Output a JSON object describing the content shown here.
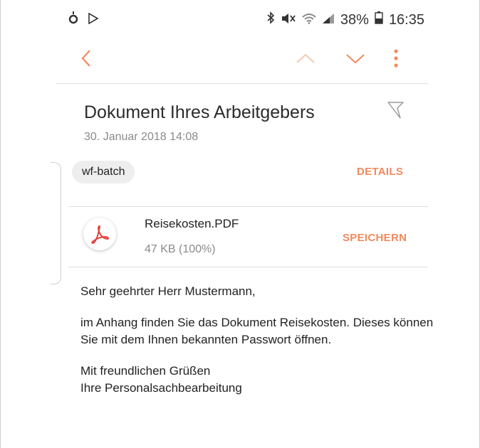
{
  "statusbar": {
    "battery_percent": "38%",
    "time": "16:35"
  },
  "email": {
    "subject": "Dokument Ihres Arbeitgebers",
    "date": "30. Januar 2018  14:08",
    "label_chip": "wf-batch",
    "details_label": "DETAILS"
  },
  "attachment": {
    "filename": "Reisekosten.PDF",
    "size": "47 KB (100%)",
    "save_label": "SPEICHERN"
  },
  "body": {
    "greeting": "Sehr geehrter Herr Mustermann,",
    "paragraph": "im Anhang finden Sie das Dokument Reisekosten. Dieses können Sie mit dem Ihnen bekannten Passwort öffnen.",
    "closing": "Mit freundlichen Grüßen",
    "signature": "Ihre Personalsachbearbeitung"
  },
  "colors": {
    "accent": "#f08a5d",
    "muted": "#8a8a8a"
  },
  "icons": [
    "notification-icon",
    "play-store-icon",
    "bluetooth-icon",
    "mute-icon",
    "wifi-icon",
    "signal-icon",
    "battery-icon",
    "back-chevron-icon",
    "previous-chevron-icon",
    "next-chevron-icon",
    "more-vert-icon",
    "flag-icon",
    "pdf-icon"
  ]
}
